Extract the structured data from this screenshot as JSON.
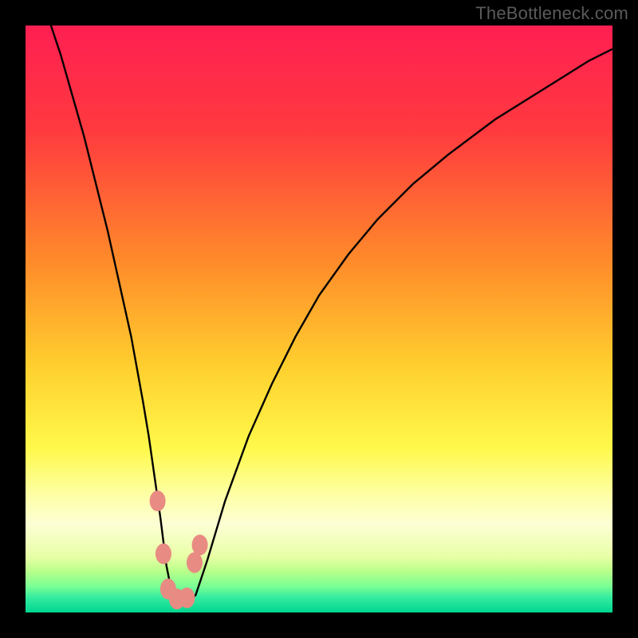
{
  "watermark": "TheBottleneck.com",
  "chart_data": {
    "type": "line",
    "title": "",
    "xlabel": "",
    "ylabel": "",
    "xlim": [
      0,
      100
    ],
    "ylim": [
      0,
      100
    ],
    "series": [
      {
        "name": "bottleneck-curve",
        "x": [
          4,
          6,
          8,
          10,
          12,
          14,
          16,
          18,
          20,
          21,
          22,
          23,
          24,
          25,
          26,
          27,
          28,
          29,
          31,
          34,
          38,
          42,
          46,
          50,
          55,
          60,
          66,
          72,
          80,
          88,
          96,
          100
        ],
        "values": [
          101,
          95,
          88,
          81,
          73,
          65,
          56,
          47,
          36,
          30,
          23,
          16,
          8,
          3,
          1.5,
          1.5,
          2.0,
          3,
          9,
          19,
          30,
          39,
          47,
          54,
          61,
          67,
          73,
          78,
          84,
          89,
          94,
          96
        ]
      }
    ],
    "markers": [
      {
        "name": "left-marker-upper",
        "x": 22.5,
        "y": 19
      },
      {
        "name": "left-marker-lower",
        "x": 23.5,
        "y": 10
      },
      {
        "name": "right-marker-upper",
        "x": 28.8,
        "y": 8.5
      },
      {
        "name": "right-marker-lower",
        "x": 29.7,
        "y": 11.5
      },
      {
        "name": "bottom-marker-1",
        "x": 24.3,
        "y": 4
      },
      {
        "name": "bottom-marker-2",
        "x": 25.8,
        "y": 2.3
      },
      {
        "name": "bottom-marker-3",
        "x": 27.5,
        "y": 2.5
      }
    ],
    "gradient_bands": [
      {
        "stop": 0.0,
        "color": "#ff1f52"
      },
      {
        "stop": 0.18,
        "color": "#ff3a3f"
      },
      {
        "stop": 0.4,
        "color": "#ff8a2a"
      },
      {
        "stop": 0.58,
        "color": "#ffcf2e"
      },
      {
        "stop": 0.72,
        "color": "#fff94a"
      },
      {
        "stop": 0.8,
        "color": "#feffa6"
      },
      {
        "stop": 0.85,
        "color": "#fcffd4"
      },
      {
        "stop": 0.905,
        "color": "#e8ffa6"
      },
      {
        "stop": 0.93,
        "color": "#b8ff8a"
      },
      {
        "stop": 0.955,
        "color": "#7cff94"
      },
      {
        "stop": 0.975,
        "color": "#33eba0"
      },
      {
        "stop": 1.0,
        "color": "#00d68f"
      }
    ]
  }
}
